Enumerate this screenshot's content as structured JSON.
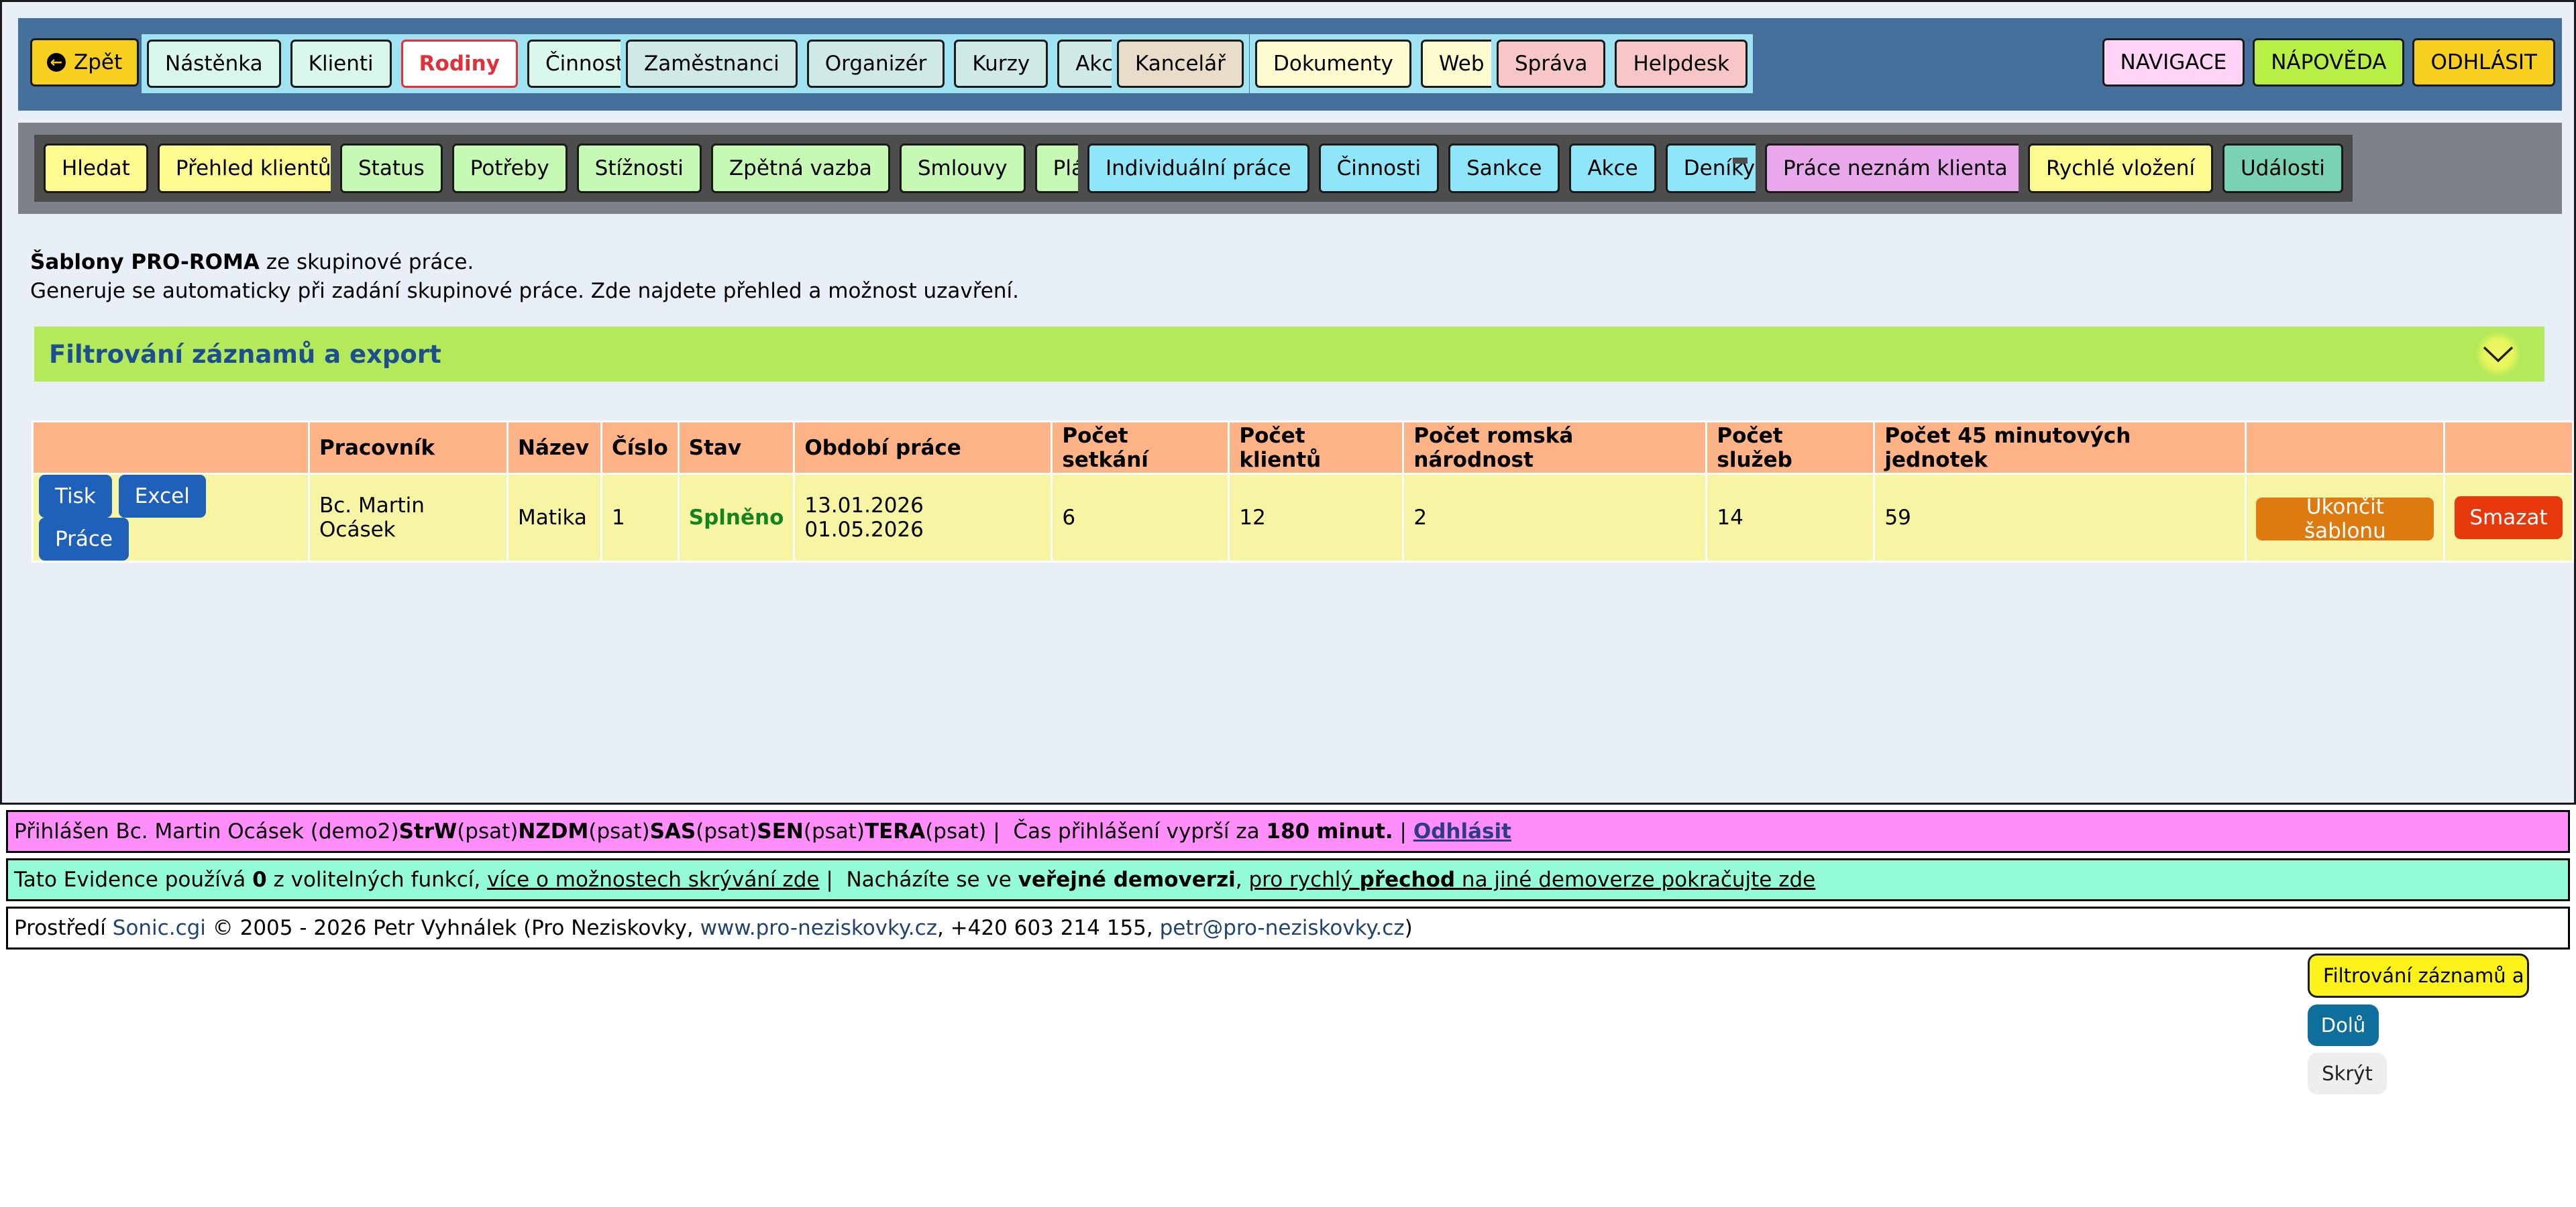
{
  "topnav": {
    "back_label": "Zpět",
    "group1": [
      "Nástěnka",
      "Klienti",
      "Rodiny",
      "Činnosti"
    ],
    "group2": [
      "Zaměstnanci",
      "Organizér",
      "Kurzy",
      "Akce"
    ],
    "group3": [
      "Kancelář"
    ],
    "group4": [
      "Dokumenty",
      "Web"
    ],
    "group5": [
      "Správa",
      "Helpdesk"
    ],
    "right": [
      "NAVIGACE",
      "NÁPOVĚDA",
      "ODHLÁSIT"
    ]
  },
  "toolbar": {
    "group1": [
      "Hledat",
      "Přehled klientů"
    ],
    "group2": [
      "Status",
      "Potřeby",
      "Stížnosti",
      "Zpětná vazba",
      "Smlouvy",
      "Plány"
    ],
    "group3": [
      "Individuální práce",
      "Činnosti",
      "Sankce",
      "Akce",
      "Deníky"
    ],
    "group4": [
      "Práce neznám klienta"
    ],
    "group5": [
      "Rychlé vložení",
      "Události"
    ]
  },
  "intro": {
    "line1_bold": "Šablony PRO-ROMA",
    "line1_rest": " ze skupinové práce.",
    "line2": "Generuje se automaticky při zadání skupinové práce. Zde najdete přehled a možnost uzavření."
  },
  "filter": {
    "title": "Filtrování záznamů a export"
  },
  "table": {
    "headers": [
      "",
      "Pracovník",
      "Název",
      "Číslo",
      "Stav",
      "Období práce",
      "Počet setkání",
      "Počet klientů",
      "Počet romská národnost",
      "Počet služeb",
      "Počet 45 minutových jednotek",
      "",
      ""
    ],
    "rows": [
      {
        "actions": [
          "Tisk",
          "Excel",
          "Práce"
        ],
        "worker": "Bc. Martin Ocásek",
        "name": "Matika",
        "number": "1",
        "status": "Splněno",
        "period": "13.01.2026 01.05.2026",
        "meetings": "6",
        "clients": "12",
        "roma": "2",
        "services": "14",
        "units45": "59",
        "end_label": "Ukončit šablonu",
        "delete_label": "Smazat"
      }
    ]
  },
  "footer": {
    "login_prefix": "Přihlášen Bc. Martin Ocásek (demo2) ",
    "roles": [
      {
        "code": "StrW",
        "perm": " (psat) "
      },
      {
        "code": "NZDM",
        "perm": " (psat) "
      },
      {
        "code": "SAS",
        "perm": " (psat) "
      },
      {
        "code": "SEN",
        "perm": " (psat) "
      },
      {
        "code": "TERA",
        "perm": " (psat) "
      }
    ],
    "sep": " | ",
    "expiry_prefix": " Čas přihlášení vyprší za ",
    "expiry_value": "180 minut.",
    "logout_link": "Odhlásit",
    "evidence_prefix": "Tato Evidence používá ",
    "evidence_count": "0",
    "evidence_mid": " z volitelných funkcí, ",
    "evidence_link": "více o možnostech skrývání zde",
    "demo_prefix": " Nacházíte se ve ",
    "demo_bold": "veřejné demoverzi",
    "demo_comma": ", ",
    "demo_link_pre": "pro rychlý ",
    "demo_link_bold": "přechod",
    "demo_link_post": " na jiné demoverze pokračujte zde",
    "env_prefix": "Prostředí ",
    "env_link": "Sonic.cgi",
    "env_mid": " © 2005 - 2026 Petr Vyhnálek (Pro Neziskovky, ",
    "env_web": "www.pro-neziskovky.cz",
    "env_phone": ", +420 603 214 155, ",
    "env_mail": "petr@pro-neziskovky.cz",
    "env_end": ")"
  },
  "floating": {
    "filter_label": "Filtrování záznamů a export",
    "down_label": "Dolů",
    "hide_label": "Skrýt"
  }
}
